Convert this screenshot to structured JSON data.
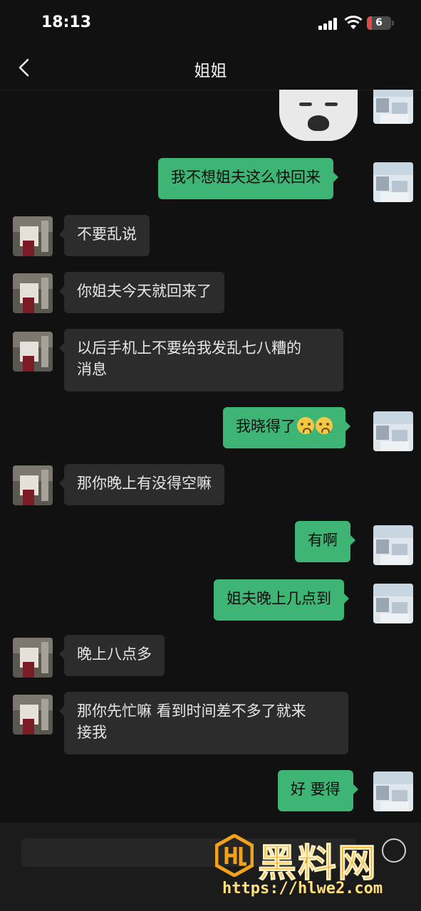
{
  "status_bar": {
    "time": "18:13",
    "battery": "6"
  },
  "nav": {
    "title": "姐姐"
  },
  "messages": [
    {
      "side": "right",
      "text": "我不想姐夫这么快回来"
    },
    {
      "side": "left",
      "text": "不要乱说"
    },
    {
      "side": "left",
      "text": "你姐夫今天就回来了"
    },
    {
      "side": "left",
      "line1": "以后手机上不要给我发乱七八糟的",
      "line2": "消息"
    },
    {
      "side": "right",
      "text": "我晓得了"
    },
    {
      "side": "left",
      "text": "那你晚上有没得空嘛"
    },
    {
      "side": "right",
      "text": "有啊"
    },
    {
      "side": "right",
      "text": "姐夫晚上几点到"
    },
    {
      "side": "left",
      "text": "晚上八点多"
    },
    {
      "side": "left",
      "line1": "那你先忙嘛 看到时间差不多了就来",
      "line2": "接我"
    },
    {
      "side": "right",
      "text": "好 要得"
    }
  ],
  "icons": {
    "back": "chevron-left-icon",
    "voice": "voice-icon",
    "emoji": "crying-emoji-icon"
  },
  "watermark": {
    "name": "黑料网",
    "url": "https://hlwe2.com"
  },
  "colors": {
    "background": "#111111",
    "bubble_right": "#3eb575",
    "bubble_left": "#2c2c2c",
    "watermark": "#f2a21a"
  }
}
